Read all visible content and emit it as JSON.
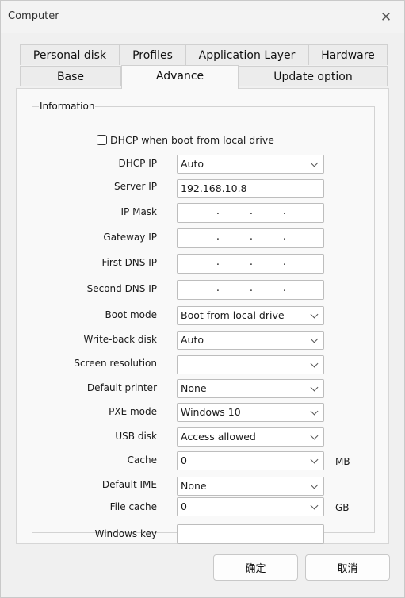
{
  "window": {
    "title": "Computer"
  },
  "tabs": {
    "row1": [
      "Personal disk",
      "Profiles",
      "Application Layer",
      "Hardware"
    ],
    "row2": [
      "Base",
      "Advance",
      "Update option"
    ],
    "active": "Advance"
  },
  "group": {
    "title": "Information",
    "dhcp_checkbox_label": "DHCP when boot from local drive",
    "dhcp_checked": false
  },
  "fields": {
    "dhcp_ip": {
      "label": "DHCP IP",
      "value": "Auto"
    },
    "server_ip": {
      "label": "Server IP",
      "value": "192.168.10.8"
    },
    "ip_mask": {
      "label": "IP Mask",
      "value": ""
    },
    "gateway_ip": {
      "label": "Gateway IP",
      "value": ""
    },
    "first_dns": {
      "label": "First DNS IP",
      "value": ""
    },
    "second_dns": {
      "label": "Second DNS IP",
      "value": ""
    },
    "boot_mode": {
      "label": "Boot mode",
      "value": "Boot from local drive"
    },
    "write_back": {
      "label": "Write-back disk",
      "value": "Auto"
    },
    "screen_res": {
      "label": "Screen resolution",
      "value": ""
    },
    "printer": {
      "label": "Default printer",
      "value": "None"
    },
    "pxe_mode": {
      "label": "PXE mode",
      "value": "Windows 10"
    },
    "usb_disk": {
      "label": "USB disk",
      "value": "Access allowed"
    },
    "cache": {
      "label": "Cache",
      "value": "0",
      "unit": "MB"
    },
    "ime": {
      "label": "Default IME",
      "value": "None"
    },
    "file_cache": {
      "label": "File cache",
      "value": "0",
      "unit": "GB"
    },
    "win_key": {
      "label": "Windows key",
      "value": ""
    }
  },
  "buttons": {
    "ok": "确定",
    "cancel": "取消"
  }
}
